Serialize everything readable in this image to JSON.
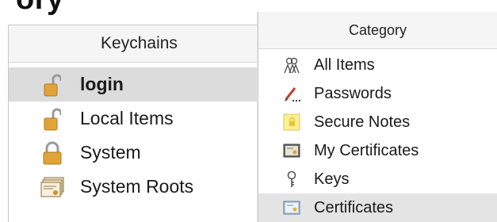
{
  "page": {
    "heading_fragment": "ory"
  },
  "keychains": {
    "header": "Keychains",
    "items": [
      {
        "label": "login",
        "icon": "unlocked-padlock-icon",
        "selected": true
      },
      {
        "label": "Local Items",
        "icon": "unlocked-padlock-icon",
        "selected": false
      },
      {
        "label": "System",
        "icon": "locked-padlock-icon",
        "selected": false
      },
      {
        "label": "System Roots",
        "icon": "certificate-stack-icon",
        "selected": false
      }
    ]
  },
  "category": {
    "header": "Category",
    "items": [
      {
        "label": "All Items",
        "icon": "people-icon",
        "selected": false
      },
      {
        "label": "Passwords",
        "icon": "pen-icon",
        "selected": false
      },
      {
        "label": "Secure Notes",
        "icon": "note-icon",
        "selected": false
      },
      {
        "label": "My Certificates",
        "icon": "my-certificate-icon",
        "selected": false
      },
      {
        "label": "Keys",
        "icon": "key-icon",
        "selected": false
      },
      {
        "label": "Certificates",
        "icon": "certificate-icon",
        "selected": true
      }
    ]
  },
  "colors": {
    "selection": "#dcdcdc",
    "header_bg": "#f5f5f5",
    "padlock_gold": "#e0a43a"
  }
}
